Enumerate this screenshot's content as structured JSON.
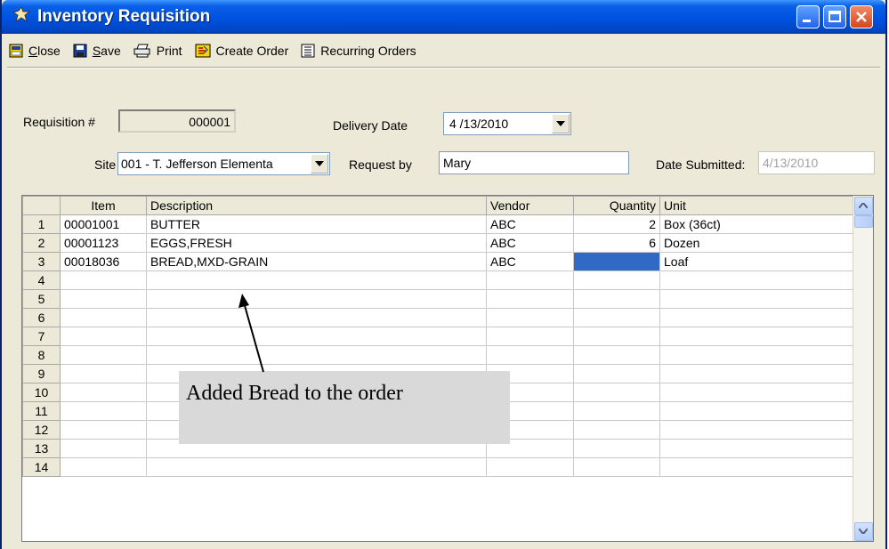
{
  "window": {
    "title": "Inventory Requisition"
  },
  "toolbar": {
    "close": {
      "prefix": "",
      "ul": "C",
      "rest": "lose"
    },
    "save": {
      "prefix": "",
      "ul": "S",
      "rest": "ave"
    },
    "print": {
      "label": "Print"
    },
    "create_order": {
      "label": "Create Order"
    },
    "recurring_orders": {
      "label": "Recurring Orders"
    }
  },
  "form": {
    "requisition_label": "Requisition #",
    "requisition_value": "000001",
    "delivery_label": "Delivery Date",
    "delivery_value": "4 /13/2010",
    "site_label": "Site",
    "site_value": "001 - T. Jefferson Elementa",
    "request_by_label": "Request by",
    "request_by_value": "Mary",
    "date_submitted_label": "Date Submitted:",
    "date_submitted_value": "4/13/2010"
  },
  "grid": {
    "columns": [
      "Item",
      "Description",
      "Vendor",
      "Quantity",
      "Unit"
    ],
    "rows": [
      {
        "n": "1",
        "item": "00001001",
        "desc": "BUTTER",
        "vendor": "ABC",
        "qty": "2",
        "unit": "Box (36ct)"
      },
      {
        "n": "2",
        "item": "00001123",
        "desc": "EGGS,FRESH",
        "vendor": "ABC",
        "qty": "6",
        "unit": "Dozen"
      },
      {
        "n": "3",
        "item": "00018036",
        "desc": "BREAD,MXD-GRAIN",
        "vendor": "ABC",
        "qty": "",
        "unit": "Loaf"
      },
      {
        "n": "4",
        "item": "",
        "desc": "",
        "vendor": "",
        "qty": "",
        "unit": ""
      },
      {
        "n": "5",
        "item": "",
        "desc": "",
        "vendor": "",
        "qty": "",
        "unit": ""
      },
      {
        "n": "6",
        "item": "",
        "desc": "",
        "vendor": "",
        "qty": "",
        "unit": ""
      },
      {
        "n": "7",
        "item": "",
        "desc": "",
        "vendor": "",
        "qty": "",
        "unit": ""
      },
      {
        "n": "8",
        "item": "",
        "desc": "",
        "vendor": "",
        "qty": "",
        "unit": ""
      },
      {
        "n": "9",
        "item": "",
        "desc": "",
        "vendor": "",
        "qty": "",
        "unit": ""
      },
      {
        "n": "10",
        "item": "",
        "desc": "",
        "vendor": "",
        "qty": "",
        "unit": ""
      },
      {
        "n": "11",
        "item": "",
        "desc": "",
        "vendor": "",
        "qty": "",
        "unit": ""
      },
      {
        "n": "12",
        "item": "",
        "desc": "",
        "vendor": "",
        "qty": "",
        "unit": ""
      },
      {
        "n": "13",
        "item": "",
        "desc": "",
        "vendor": "",
        "qty": "",
        "unit": ""
      },
      {
        "n": "14",
        "item": "",
        "desc": "",
        "vendor": "",
        "qty": "",
        "unit": ""
      }
    ],
    "selected_color": "#316ac5"
  },
  "annotation": {
    "text": "Added Bread to the order"
  },
  "icons": {
    "title": "folder-star-icon",
    "close": "door-icon",
    "save": "floppy-disk-icon",
    "print": "printer-icon",
    "create_order": "order-icon",
    "recurring_orders": "list-icon"
  },
  "colors": {
    "titlebar": "#0054e3",
    "window_bg": "#ece9d8",
    "close_button": "#d4461e"
  }
}
